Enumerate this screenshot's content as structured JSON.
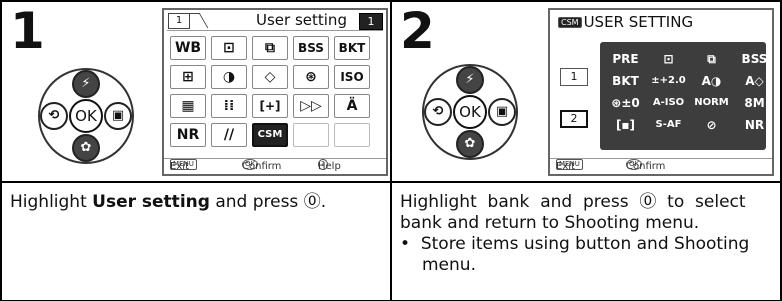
{
  "step1": {
    "number": "1",
    "screen_title": "User setting",
    "screen_tab": "1",
    "screen_badge": "1",
    "icons": [
      "WB",
      "⊡",
      "⧉",
      "BSS",
      "BKT",
      "⊞",
      "◑",
      "◇",
      "⊛",
      "ISO",
      "▦",
      "⁞⁞",
      "[+]",
      "▷▷",
      "Ä",
      "NR",
      "//",
      "CSM",
      "",
      ""
    ],
    "footer": {
      "menu_chip": "MENU",
      "exit": "Exit",
      "ok_chip": "OK",
      "confirm": "Confirm",
      "help_icon": "?",
      "help": "Help"
    },
    "desc_prefix": "Highlight ",
    "desc_bold": "User setting",
    "desc_suffix": " and press ⓪.",
    "dpad": {
      "up": "⚡",
      "left": "⟲",
      "right": "▣",
      "down": "✿",
      "ok": "OK"
    }
  },
  "step2": {
    "number": "2",
    "screen_title": "USER SETTING",
    "title_chip": "CSM",
    "banks": [
      "1",
      "2"
    ],
    "csm_items": [
      "PRE",
      "⊡",
      "⧉",
      "BSS",
      "BKT",
      "±+2.0",
      "A◑",
      "A◇",
      "⊛±0",
      "A-ISO",
      "NORM",
      "8M",
      "[▪]",
      "S-AF",
      "⊘",
      "NR"
    ],
    "footer": {
      "menu_chip": "MENU",
      "exit": "Exit",
      "ok_chip": "OK",
      "confirm": "Confirm"
    },
    "desc_line1": "Highlight  bank  and  press  ⓪  to  select",
    "desc_line2": "bank and return to Shooting menu.",
    "bullet_line1": "•  Store items using button and Shooting",
    "bullet_line2": "menu.",
    "dpad": {
      "up": "⚡",
      "left": "⟲",
      "right": "▣",
      "down": "✿",
      "ok": "OK"
    }
  }
}
